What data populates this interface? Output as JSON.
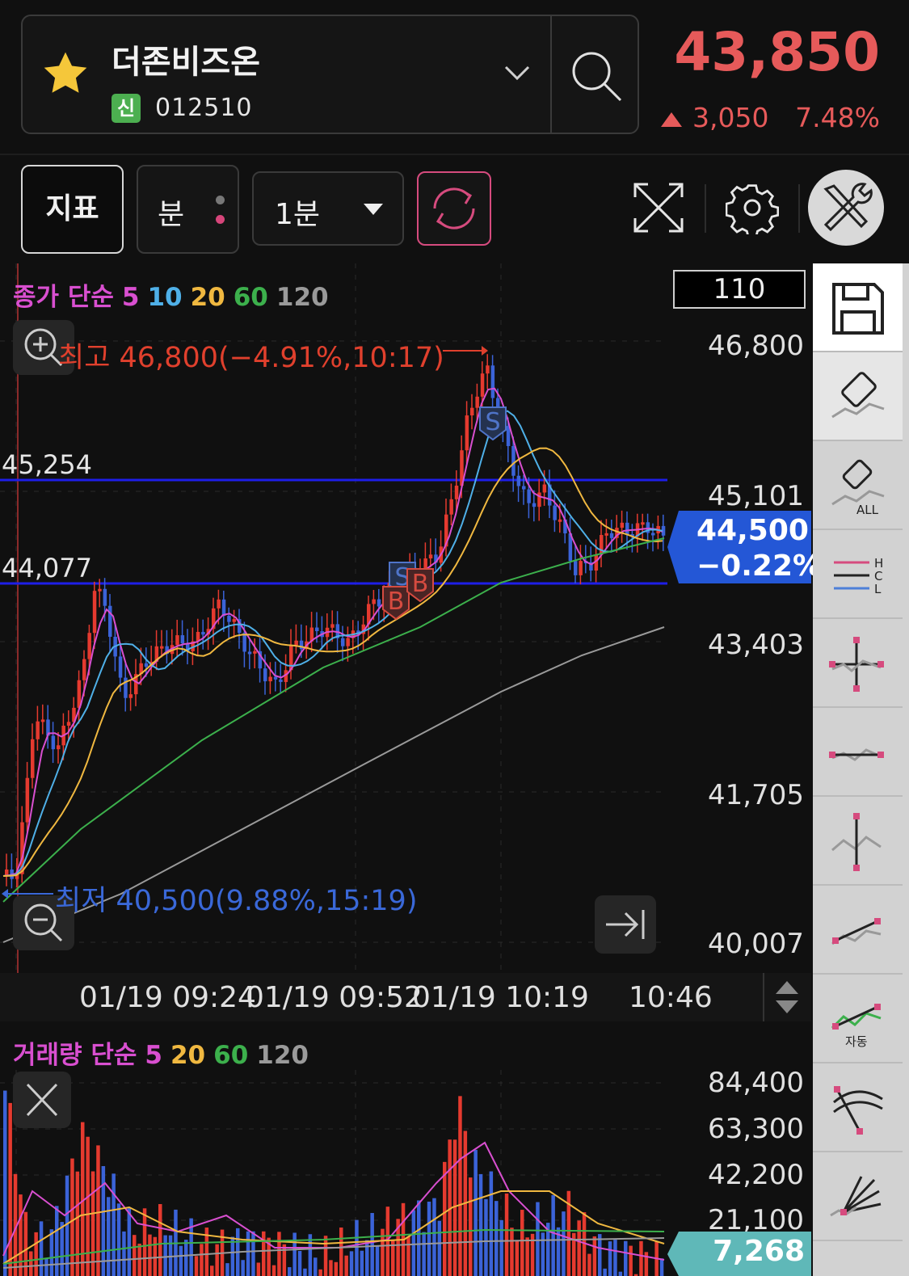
{
  "header": {
    "stock_name": "더존비즈온",
    "market_badge": "신",
    "stock_code": "012510",
    "price": "43,850",
    "change": "3,050",
    "change_pct": "7.48%",
    "up_color": "#e65a5a"
  },
  "toolbar": {
    "indicator_label": "지표",
    "period_label": "분",
    "interval_selected": "1분",
    "icons": [
      "refresh-icon",
      "expand-icon",
      "gear-icon",
      "tools-icon"
    ]
  },
  "price_chart": {
    "legend": {
      "base": "종가 단순",
      "ma": [
        "5",
        "10",
        "20",
        "60",
        "120"
      ],
      "colors": [
        "#d94fd0",
        "#4fb0e8",
        "#f0b840",
        "#3cb04c",
        "#9a9a9a"
      ]
    },
    "bar_count": "110",
    "high_label": "최고 46,800(−4.91%,10:17)",
    "low_label": "최저 40,500(9.88%,15:19)",
    "hline_upper": "45,254",
    "hline_lower": "44,077",
    "y_ticks": [
      "46,800",
      "45,101",
      "43,403",
      "41,705",
      "40,007"
    ],
    "current_price": "44,500",
    "current_pct": "−0.22%",
    "current_tag_color": "#2457d6",
    "x_ticks": [
      "01/19 09:24",
      "01/19 09:52",
      "01/19 10:19",
      "10:46"
    ],
    "signals": [
      "S",
      "S",
      "B",
      "B"
    ]
  },
  "volume_chart": {
    "legend": {
      "base": "거래량 단순",
      "ma": [
        "5",
        "20",
        "60",
        "120"
      ],
      "colors": [
        "#d94fd0",
        "#f0b840",
        "#3cb04c",
        "#9a9a9a"
      ]
    },
    "y_ticks": [
      "84,400",
      "63,300",
      "42,200",
      "21,100"
    ],
    "current_volume": "7,268",
    "tag_color": "#5fb8b8"
  },
  "right_tools": [
    "save-icon",
    "eraser-icon",
    "eraser-all-icon",
    "hcl-lines-icon",
    "crosshair-icon",
    "horizontal-line-icon",
    "vertical-line-icon",
    "trend-line-icon",
    "auto-trend-icon",
    "fan-arc-icon",
    "fan-lines-icon"
  ],
  "right_tool_labels": {
    "eraser_all": "ALL",
    "auto": "자동",
    "h": "H",
    "c": "C",
    "l": "L"
  }
}
